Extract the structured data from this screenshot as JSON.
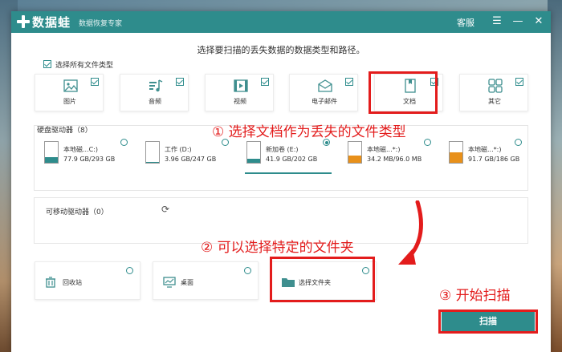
{
  "titlebar": {
    "app_name": "数据蛙",
    "app_subtitle": "数据恢复专家",
    "service_label": "客服",
    "menu_icon": "menu-icon",
    "minimize_icon": "minimize-icon",
    "close_icon": "close-icon"
  },
  "heading": "选择要扫描的丢失数据的数据类型和路径。",
  "select_all_label": "选择所有文件类型",
  "file_types": [
    {
      "label": "图片",
      "icon": "image-icon",
      "checked": true
    },
    {
      "label": "音频",
      "icon": "audio-icon",
      "checked": true
    },
    {
      "label": "视频",
      "icon": "video-icon",
      "checked": true
    },
    {
      "label": "电子邮件",
      "icon": "email-icon",
      "checked": true
    },
    {
      "label": "文档",
      "icon": "document-icon",
      "checked": true
    },
    {
      "label": "其它",
      "icon": "other-icon",
      "checked": true
    }
  ],
  "hard_drives": {
    "title": "硬盘驱动器（8）",
    "drives": [
      {
        "name": "本地磁...C:)",
        "size": "77.9 GB/293 GB",
        "used_fraction": 0.27,
        "selected": false
      },
      {
        "name": "工作 (D:)",
        "size": "3.96 GB/247 GB",
        "used_fraction": 0.02,
        "selected": false
      },
      {
        "name": "新加卷 (E:)",
        "size": "41.9 GB/202 GB",
        "used_fraction": 0.21,
        "selected": true
      },
      {
        "name": "本地磁...*:)",
        "size": "34.2 MB/96.0 MB",
        "used_fraction": 0.36,
        "selected": false
      },
      {
        "name": "本地磁...*:)",
        "size": "91.7 GB/186 GB",
        "used_fraction": 0.49,
        "selected": false
      }
    ]
  },
  "removable_drives": {
    "title": "可移动驱动器（0）"
  },
  "locations": [
    {
      "label": "回收站",
      "icon": "recycle-bin-icon"
    },
    {
      "label": "桌面",
      "icon": "desktop-icon"
    },
    {
      "label": "选择文件夹",
      "icon": "folder-icon"
    }
  ],
  "scan_button": "扫描",
  "annotations": {
    "step1": "① 选择文档作为丢失的文件类型",
    "step2": "② 可以选择特定的文件夹",
    "step3": "③ 开始扫描"
  },
  "colors": {
    "accent": "#2e8c8c",
    "annotation_red": "#e31c1c",
    "drive_fill_teal": "#2e8c8c",
    "drive_fill_orange": "#e8901a"
  }
}
